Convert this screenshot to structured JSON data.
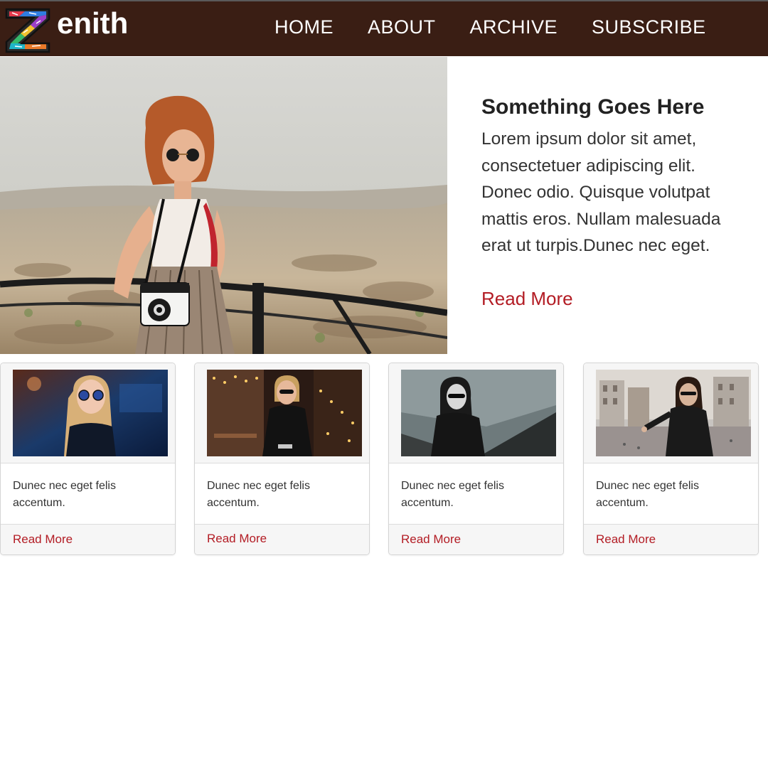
{
  "brand": {
    "logo_letter": "Z",
    "name_rest": "enith"
  },
  "nav": {
    "items": [
      "HOME",
      "ABOUT",
      "ARCHIVE",
      "SUBSCRIBE"
    ]
  },
  "hero": {
    "image": "woman-with-camera-photo",
    "title": "Something Goes Here",
    "body": "Lorem ipsum dolor sit amet, consectetuer adipiscing elit. Donec odio. Quisque volutpat mattis eros. Nullam malesuada erat ut turpis.Dunec nec eget.",
    "link": "Read More"
  },
  "cards": [
    {
      "image": "woman-sunglasses-blue-photo",
      "text": "Dunec nec eget felis accentum.",
      "link": "Read More"
    },
    {
      "image": "woman-phone-street-photo",
      "text": "Dunec nec eget felis accentum.",
      "link": "Read More"
    },
    {
      "image": "woman-bw-waterfront-photo",
      "text": "Dunec nec eget felis accentum.",
      "link": "Read More"
    },
    {
      "image": "woman-city-square-photo",
      "text": "Dunec nec eget felis accentum.",
      "link": "Read More"
    }
  ],
  "colors": {
    "header_bg": "#3a1e14",
    "accent_link": "#b31c24"
  }
}
